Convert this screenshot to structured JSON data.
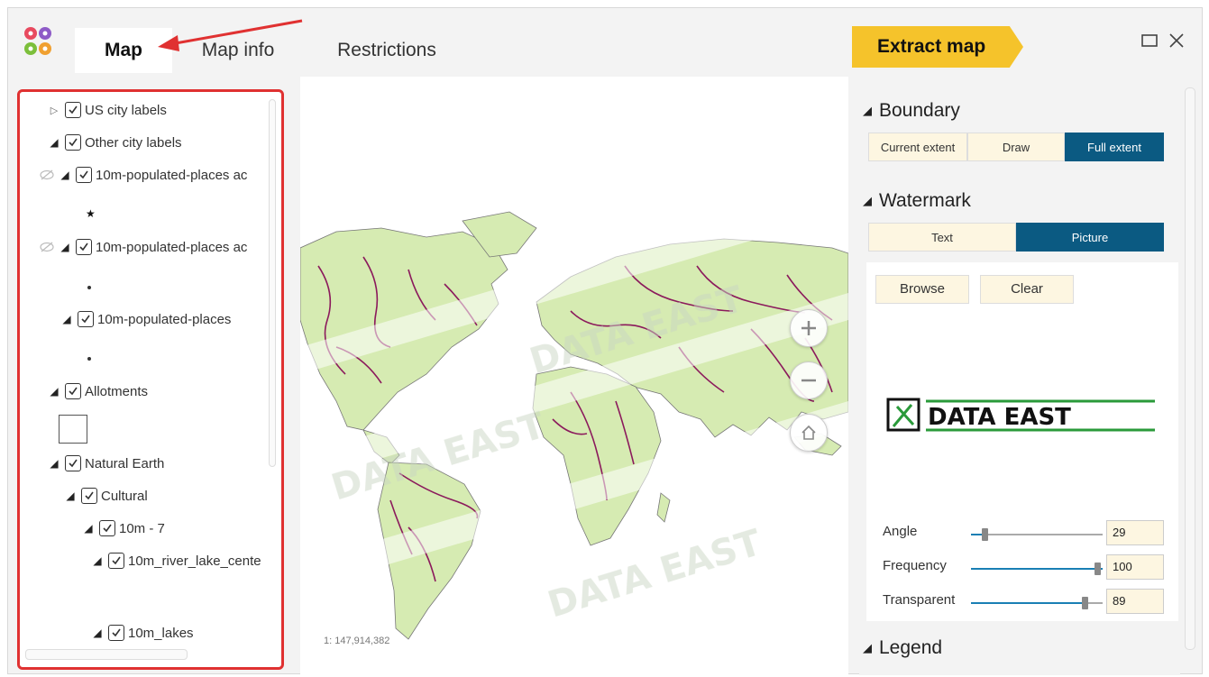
{
  "tabs": [
    {
      "label": "Map"
    },
    {
      "label": "Map info"
    },
    {
      "label": "Restrictions"
    }
  ],
  "actions": {
    "extract_label": "Extract map"
  },
  "colors": {
    "accent_yellow": "#f5c32b",
    "active_blue": "#0b5a82",
    "highlight_red": "#e03131",
    "land_green": "#d6ebb2",
    "river_purple": "#8b1a5c"
  },
  "layers": [
    {
      "label": "US city labels",
      "expander": "collapsed"
    },
    {
      "label": "Other city labels",
      "expander": "expanded"
    },
    {
      "label": "10m-populated-places ac",
      "expander": "expanded",
      "hidden_icon": "eye-off-icon"
    },
    {
      "label": "10m-populated-places ac",
      "expander": "expanded",
      "hidden_icon": "eye-off-icon"
    },
    {
      "label": "10m-populated-places",
      "expander": "expanded"
    },
    {
      "label": "Allotments",
      "expander": "expanded"
    },
    {
      "label": "Natural Earth",
      "expander": "expanded"
    },
    {
      "label": "Cultural",
      "expander": "expanded"
    },
    {
      "label": "10m - 7",
      "expander": "expanded"
    },
    {
      "label": "10m_river_lake_cente",
      "expander": "expanded"
    },
    {
      "label": "10m_lakes",
      "expander": "expanded"
    }
  ],
  "map": {
    "scale": "1: 147,914,382",
    "watermark_text": "DATA EAST"
  },
  "boundary": {
    "title": "Boundary",
    "options": [
      "Current extent",
      "Draw",
      "Full extent"
    ],
    "selected": "Full extent"
  },
  "watermark": {
    "title": "Watermark",
    "options": [
      "Text",
      "Picture"
    ],
    "selected": "Picture",
    "browse_label": "Browse",
    "clear_label": "Clear",
    "logo_text": "DATA EAST",
    "angle": {
      "label": "Angle",
      "value": "29"
    },
    "frequency": {
      "label": "Frequency",
      "value": "100"
    },
    "transparent": {
      "label": "Transparent",
      "value": "89"
    }
  },
  "legend": {
    "title": "Legend"
  }
}
